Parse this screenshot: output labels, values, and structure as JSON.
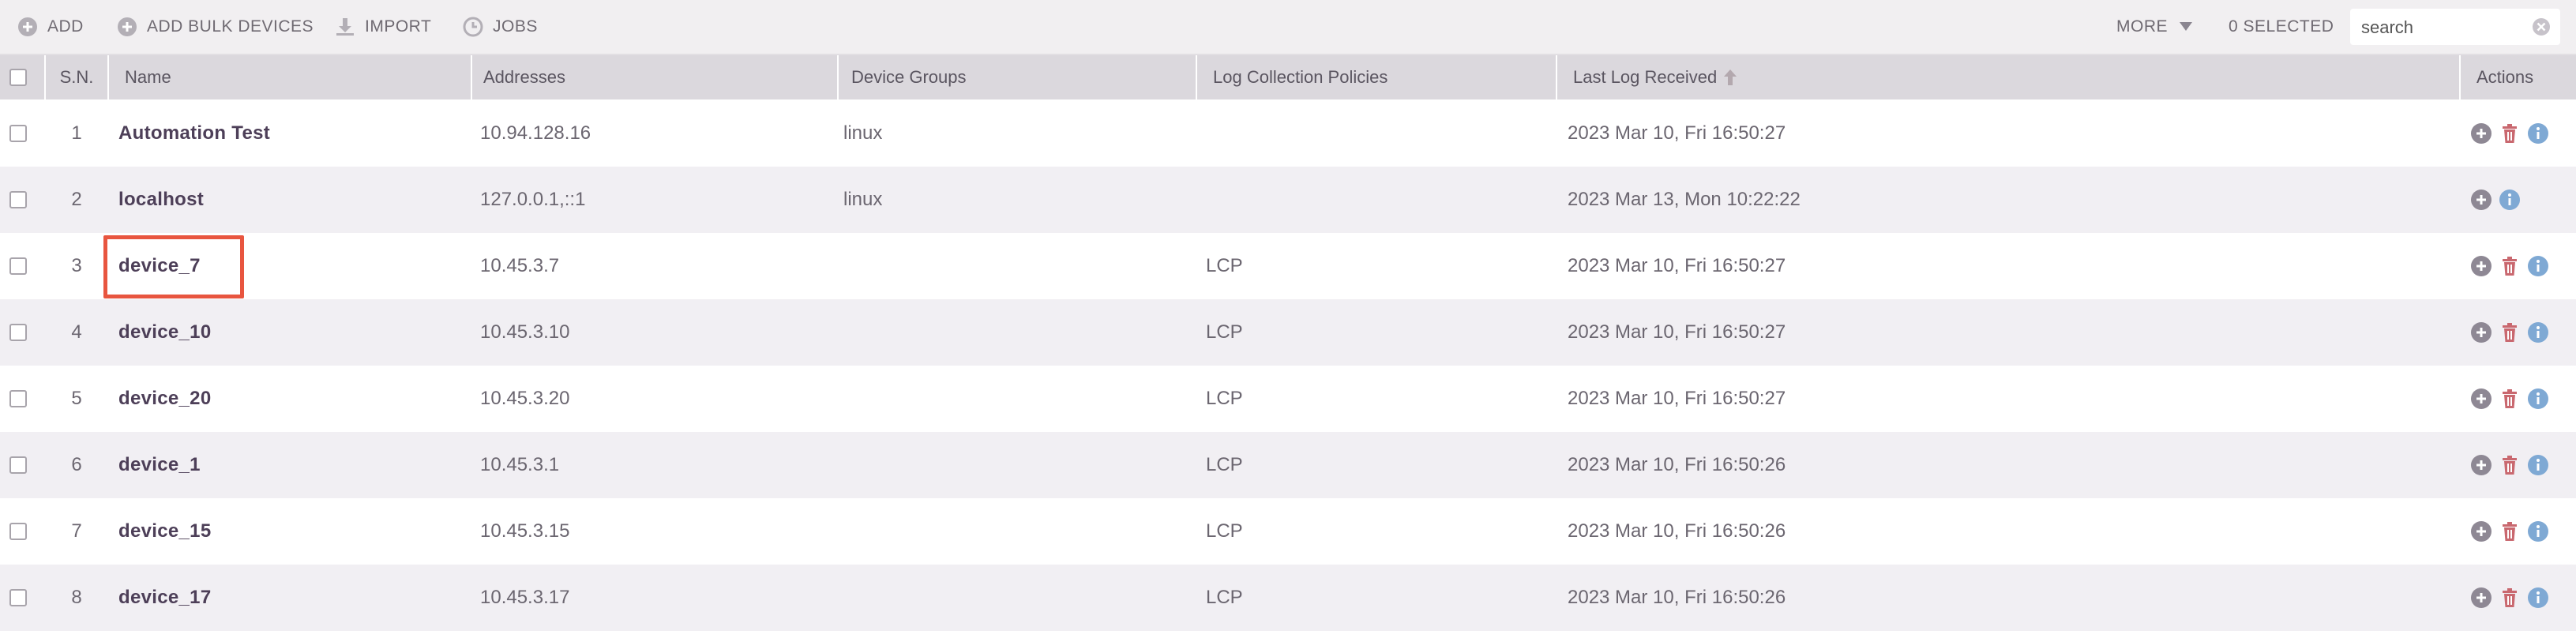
{
  "toolbar": {
    "add_label": "ADD",
    "bulk_label": "ADD BULK DEVICES",
    "import_label": "IMPORT",
    "jobs_label": "JOBS",
    "more_label": "MORE",
    "selected_label": "0 SELECTED",
    "search_placeholder": "search"
  },
  "table": {
    "headers": {
      "sn": "S.N.",
      "name": "Name",
      "addresses": "Addresses",
      "device_groups": "Device Groups",
      "lcp": "Log Collection Policies",
      "last_log": "Last Log Received",
      "actions": "Actions"
    },
    "rows": [
      {
        "sn": "1",
        "name": "Automation Test",
        "address": "10.94.128.16",
        "group": "linux",
        "lcp": "",
        "last_log": "2023 Mar 10, Fri 16:50:27",
        "has_delete": true
      },
      {
        "sn": "2",
        "name": "localhost",
        "address": "127.0.0.1,::1",
        "group": "linux",
        "lcp": "",
        "last_log": "2023 Mar 13, Mon 10:22:22",
        "has_delete": false
      },
      {
        "sn": "3",
        "name": "device_7",
        "address": "10.45.3.7",
        "group": "",
        "lcp": "LCP",
        "last_log": "2023 Mar 10, Fri 16:50:27",
        "has_delete": true
      },
      {
        "sn": "4",
        "name": "device_10",
        "address": "10.45.3.10",
        "group": "",
        "lcp": "LCP",
        "last_log": "2023 Mar 10, Fri 16:50:27",
        "has_delete": true
      },
      {
        "sn": "5",
        "name": "device_20",
        "address": "10.45.3.20",
        "group": "",
        "lcp": "LCP",
        "last_log": "2023 Mar 10, Fri 16:50:27",
        "has_delete": true
      },
      {
        "sn": "6",
        "name": "device_1",
        "address": "10.45.3.1",
        "group": "",
        "lcp": "LCP",
        "last_log": "2023 Mar 10, Fri 16:50:26",
        "has_delete": true
      },
      {
        "sn": "7",
        "name": "device_15",
        "address": "10.45.3.15",
        "group": "",
        "lcp": "LCP",
        "last_log": "2023 Mar 10, Fri 16:50:26",
        "has_delete": true
      },
      {
        "sn": "8",
        "name": "device_17",
        "address": "10.45.3.17",
        "group": "",
        "lcp": "LCP",
        "last_log": "2023 Mar 10, Fri 16:50:26",
        "has_delete": true
      }
    ]
  },
  "icons": {
    "add": "plus-circle-icon",
    "bulk": "plus-circle-icon",
    "import": "download-icon",
    "jobs": "clock-icon",
    "more": "caret-down-icon",
    "clear": "clear-icon",
    "sort": "sort-ascending-icon",
    "row_add": "plus-circle-icon",
    "row_delete": "trash-icon",
    "row_info": "info-icon"
  },
  "colors": {
    "toolbar_bg": "#f1eff1",
    "header_bg": "#dbd8dd",
    "alt_row_bg": "#f1eff3",
    "name_text": "#4d3f58",
    "delete_icon": "#c9686f",
    "info_icon": "#7fa9d4",
    "highlight": "#e8553f"
  }
}
